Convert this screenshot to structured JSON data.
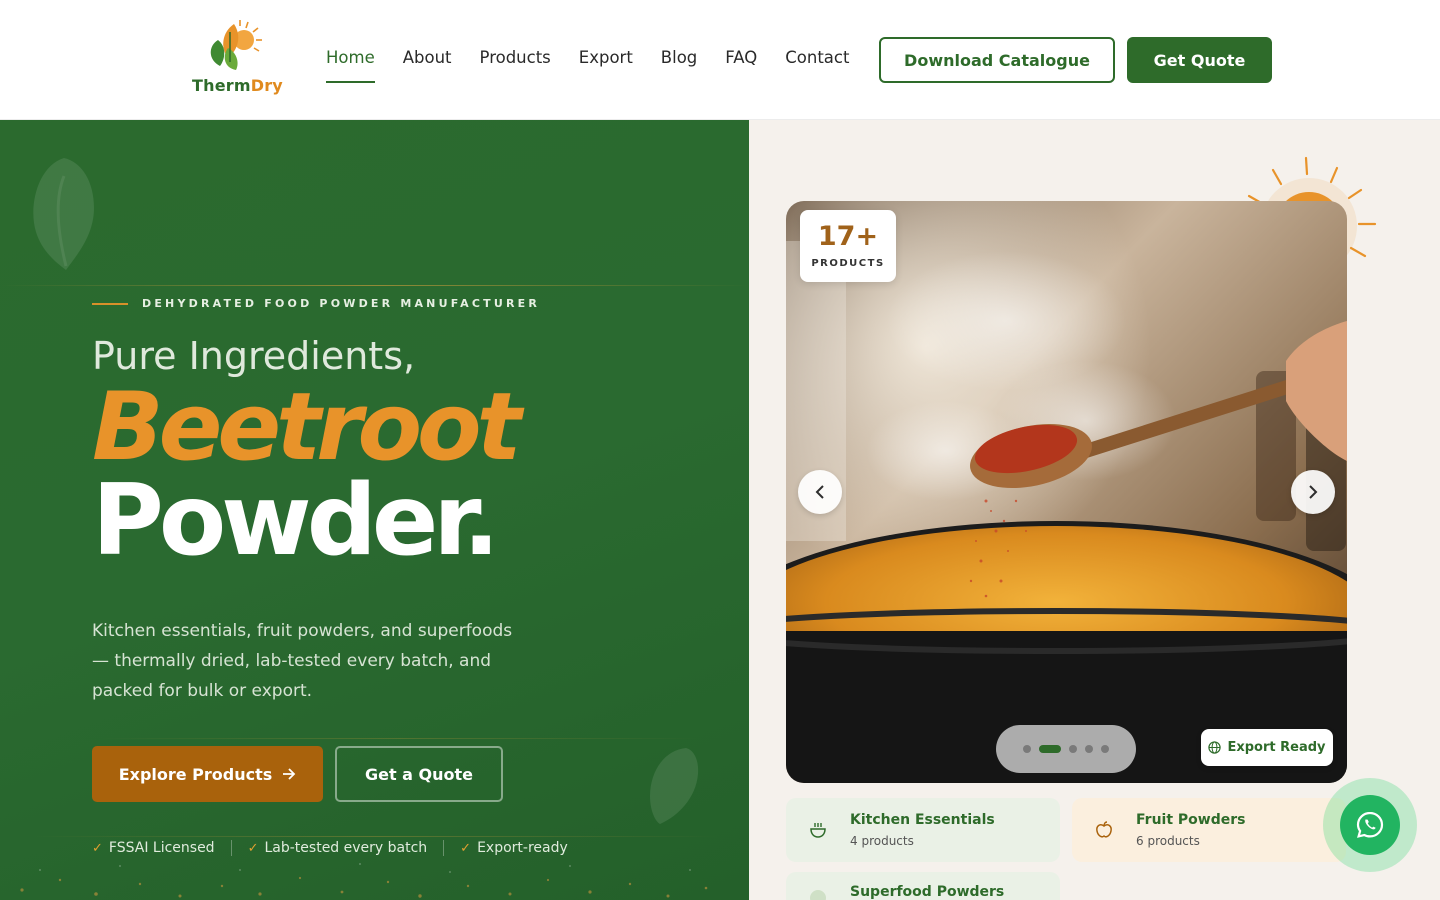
{
  "brand": {
    "name_part1": "Therm",
    "name_part2": "Dry"
  },
  "nav": {
    "items": [
      {
        "label": "Home",
        "active": true
      },
      {
        "label": "About"
      },
      {
        "label": "Products"
      },
      {
        "label": "Export"
      },
      {
        "label": "Blog"
      },
      {
        "label": "FAQ"
      },
      {
        "label": "Contact"
      }
    ],
    "download_label": "Download Catalogue",
    "quote_label": "Get Quote"
  },
  "hero": {
    "eyebrow": "DEHYDRATED FOOD POWDER MANUFACTURER",
    "title_pre": "Pure Ingredients,",
    "title_accent": "Beetroot",
    "title_main": "Powder.",
    "description": "Kitchen essentials, fruit powders, and superfoods — thermally dried, lab-tested every batch, and packed for bulk or export.",
    "explore_label": "Explore Products",
    "quote_label": "Get a Quote",
    "badges": [
      "FSSAI Licensed",
      "Lab-tested every batch",
      "Export-ready"
    ]
  },
  "showcase": {
    "stat_number": "17+",
    "stat_label": "PRODUCTS",
    "export_label": "Export Ready",
    "slide_count": 5,
    "active_slide": 2,
    "categories": [
      {
        "title": "Kitchen Essentials",
        "subtitle": "4 products"
      },
      {
        "title": "Fruit Powders",
        "subtitle": "6 products"
      },
      {
        "title": "Superfood Powders",
        "subtitle": ""
      }
    ]
  },
  "colors": {
    "brand_green": "#2e6b2a",
    "accent_orange": "#e8932a",
    "button_brown": "#a9620c",
    "whatsapp": "#22b461"
  }
}
